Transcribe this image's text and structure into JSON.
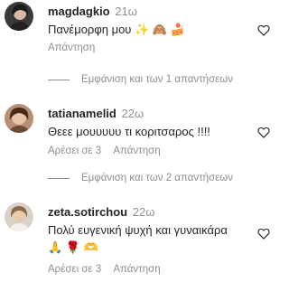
{
  "comments": [
    {
      "username": "magdagkio",
      "time": "21ω",
      "text": "Πανέμορφη μου ✨ 🙈 🍰",
      "likes": "",
      "reply_label": "Απάντηση",
      "avatar_icon": "user-avatar-magdagkio",
      "heart_icon": "heart-outline-icon"
    },
    {
      "username": "tatianamelid",
      "time": "22ω",
      "text": "Θεεε μουυυυυ τι κοριτσαρος !!!!",
      "likes": "Αρέσει σε 3",
      "reply_label": "Απάντηση",
      "avatar_icon": "user-avatar-tatianamelid",
      "heart_icon": "heart-outline-icon"
    },
    {
      "username": "zeta.sotirchou",
      "time": "22ω",
      "text": "Πολύ ευγενική ψυχή και γυναικάρα 🙏 🌹 🫶",
      "likes": "Αρέσει σε 3",
      "reply_label": "Απάντηση",
      "avatar_icon": "user-avatar-zeta",
      "heart_icon": "heart-outline-icon"
    }
  ],
  "view_replies": [
    {
      "label": "Εμφάνιση και των 1 απαντήσεων"
    },
    {
      "label": "Εμφάνιση και των 2 απαντήσεων"
    }
  ],
  "colors": {
    "text": "#262626",
    "secondary": "#8e8e8e",
    "background": "#ffffff"
  }
}
